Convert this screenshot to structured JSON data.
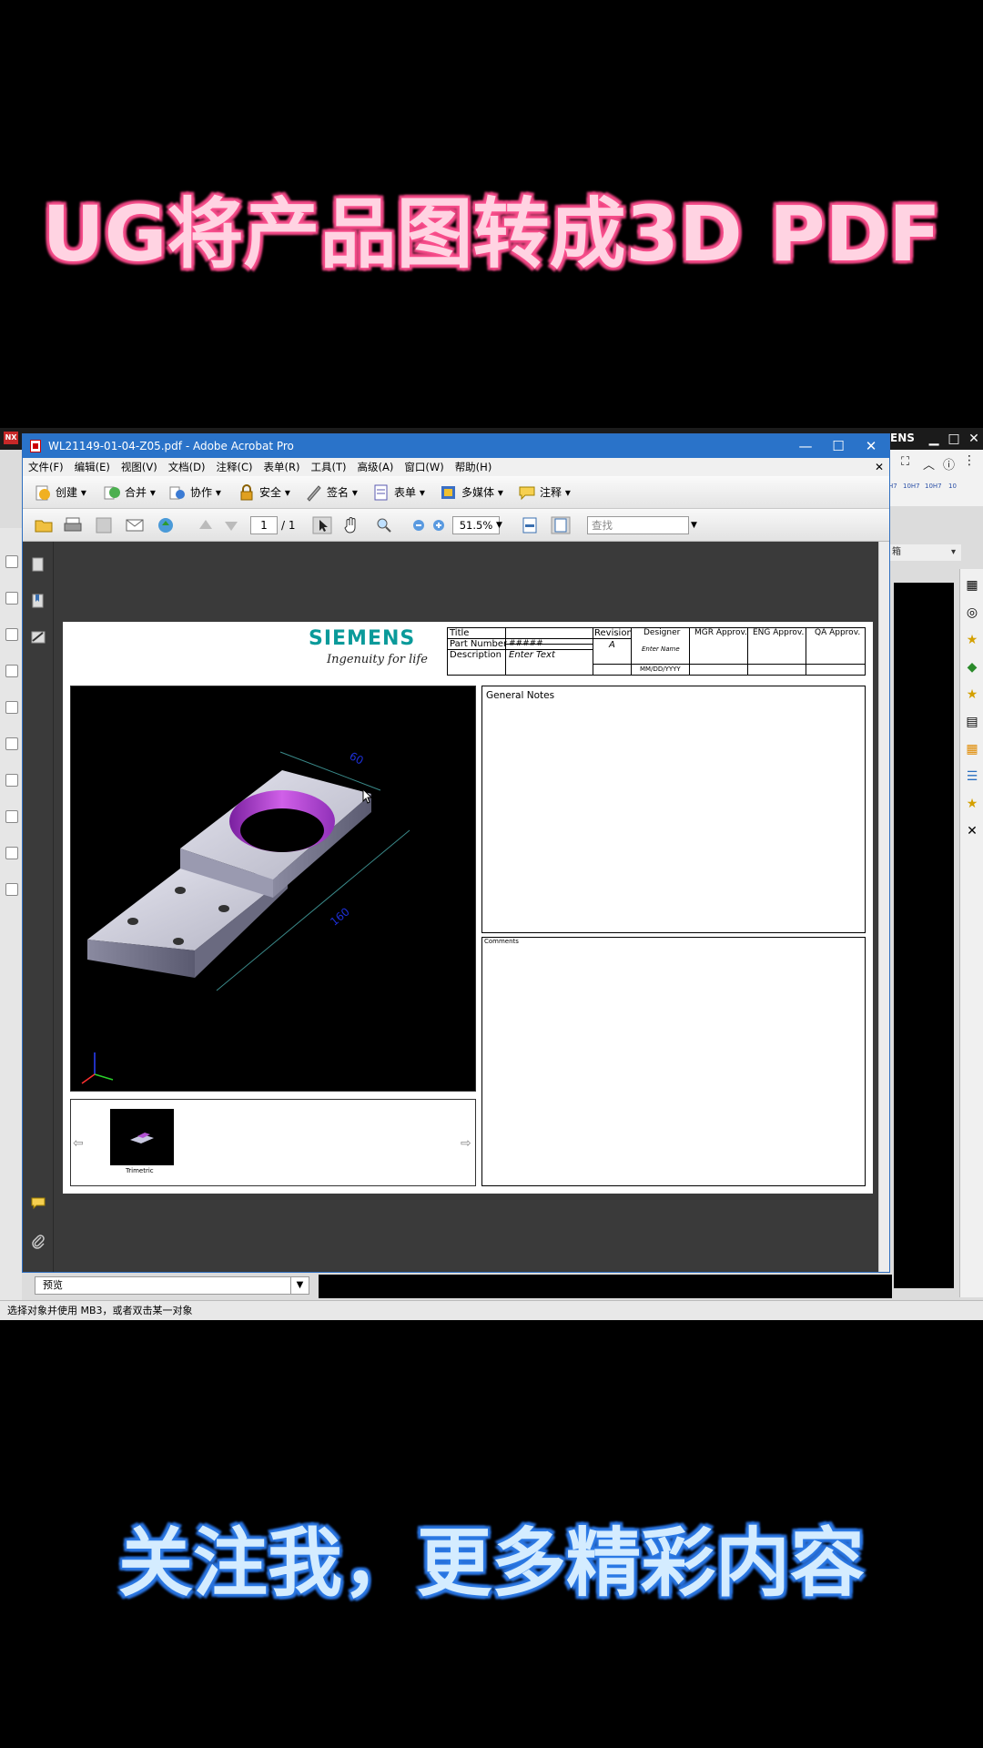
{
  "overlay": {
    "title_top": "UG将产品图转成3D PDF",
    "title_bottom": "关注我，更多精彩内容"
  },
  "nx": {
    "logo": "NX",
    "brand": "ENS",
    "ribbon_small": [
      "H7",
      "10H7",
      "10H7",
      "10"
    ],
    "dropdown_label": "箱",
    "preview_label": "预览",
    "status_text": "选择对象并使用 MB3，或者双击某一对象",
    "right_panel_icons": [
      "grid-icon",
      "eye-off-icon",
      "star-icon",
      "shape-icon",
      "star-icon",
      "clipboard-icon",
      "table-icon",
      "layers-icon",
      "star-icon",
      "tools-icon"
    ]
  },
  "acrobat": {
    "window_title": "WL21149-01-04-Z05.pdf - Adobe Acrobat Pro",
    "menu": [
      "文件(F)",
      "编辑(E)",
      "视图(V)",
      "文档(D)",
      "注释(C)",
      "表单(R)",
      "工具(T)",
      "高级(A)",
      "窗口(W)",
      "帮助(H)"
    ],
    "toolbar": {
      "create": "创建",
      "combine": "合并",
      "collaborate": "协作",
      "secure": "安全",
      "sign": "签名",
      "forms": "表单",
      "multimedia": "多媒体",
      "comment": "注释"
    },
    "page_current": "1",
    "page_total": "/ 1",
    "zoom": "51.5%",
    "find_placeholder": "查找"
  },
  "pdf": {
    "logo": "SIEMENS",
    "tagline": "Ingenuity for life",
    "title_block": {
      "title_label": "Title",
      "part_number_label": "Part Number",
      "part_number_value": "#####",
      "description_label": "Description",
      "description_value": "Enter Text",
      "revision_label": "Revision",
      "revision_value": "A",
      "designer_label": "Designer",
      "designer_value": "Enter Name",
      "date_value": "MM/DD/YYYY",
      "mgr_label": "MGR Approv.",
      "eng_label": "ENG Approv.",
      "qa_label": "QA Approv."
    },
    "dimensions": [
      "60",
      "160"
    ],
    "thumbnail_label": "Trimetric",
    "general_notes": "General Notes",
    "comments": "Comments"
  },
  "colors": {
    "acrobat_title_bar": "#2a73c9",
    "siemens_teal": "#0a9a9a",
    "bore_magenta": "#c040d8",
    "dimension_blue": "#1d2fd6"
  }
}
